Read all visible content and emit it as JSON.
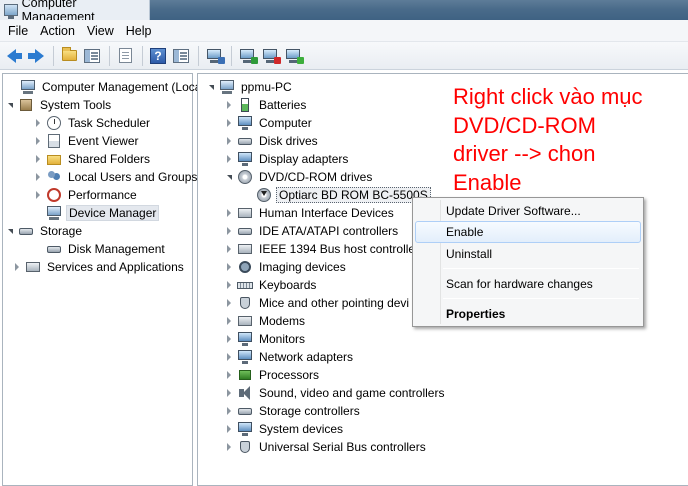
{
  "window": {
    "title": "Computer Management"
  },
  "menu": [
    "File",
    "Action",
    "View",
    "Help"
  ],
  "toolbar": {
    "buttons": [
      "back-icon",
      "forward-icon",
      "up-folder-icon",
      "show-hide-tree-icon",
      "export-list-icon",
      "help-icon",
      "properties-panel-icon",
      "scan-hardware-icon",
      "update-driver-icon",
      "uninstall-icon",
      "enable-device-icon"
    ]
  },
  "left_tree": {
    "root": "Computer Management (Local",
    "system_tools": "System Tools",
    "task_scheduler": "Task Scheduler",
    "event_viewer": "Event Viewer",
    "shared_folders": "Shared Folders",
    "local_users": "Local Users and Groups",
    "performance": "Performance",
    "device_manager": "Device Manager",
    "storage": "Storage",
    "disk_management": "Disk Management",
    "services": "Services and Applications"
  },
  "device_tree": {
    "root": "ppmu-PC",
    "batteries": "Batteries",
    "computer": "Computer",
    "disk_drives": "Disk drives",
    "display_adapters": "Display adapters",
    "dvd_drives": "DVD/CD-ROM drives",
    "optiarc": "Optiarc BD ROM BC-5500S",
    "hid": "Human Interface Devices",
    "ide": "IDE ATA/ATAPI controllers",
    "ieee": "IEEE 1394 Bus host controllers",
    "imaging": "Imaging devices",
    "keyboards": "Keyboards",
    "mice": "Mice and other pointing devi",
    "modems": "Modems",
    "monitors": "Monitors",
    "network": "Network adapters",
    "processors": "Processors",
    "sound": "Sound, video and game controllers",
    "storage_ctrl": "Storage controllers",
    "system_devices": "System devices",
    "usb": "Universal Serial Bus controllers"
  },
  "context_menu": {
    "update": "Update Driver Software...",
    "enable": "Enable",
    "uninstall": "Uninstall",
    "scan": "Scan for hardware changes",
    "properties": "Properties"
  },
  "annotation": {
    "line1": "Right click vào mục",
    "line2": "DVD/CD-ROM",
    "line3": "driver --> chon",
    "line4": "Enable",
    "color": "#ff0000"
  }
}
